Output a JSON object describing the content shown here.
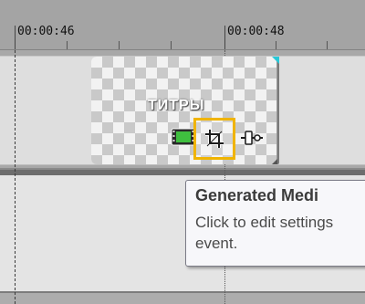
{
  "ruler": {
    "timecode_left": "00:00:46",
    "timecode_right": "00:00:48"
  },
  "clip": {
    "title": "ТИТРЫ",
    "icons": [
      "event-media-icon",
      "event-pan-crop-icon",
      "event-fx-icon"
    ],
    "colors": {
      "selection_highlight": "#f0b400",
      "corner_marker": "#28c8d8"
    }
  },
  "tooltip": {
    "title": "Generated Medi",
    "body_line1": "Click to edit settings",
    "body_line2": "event."
  }
}
